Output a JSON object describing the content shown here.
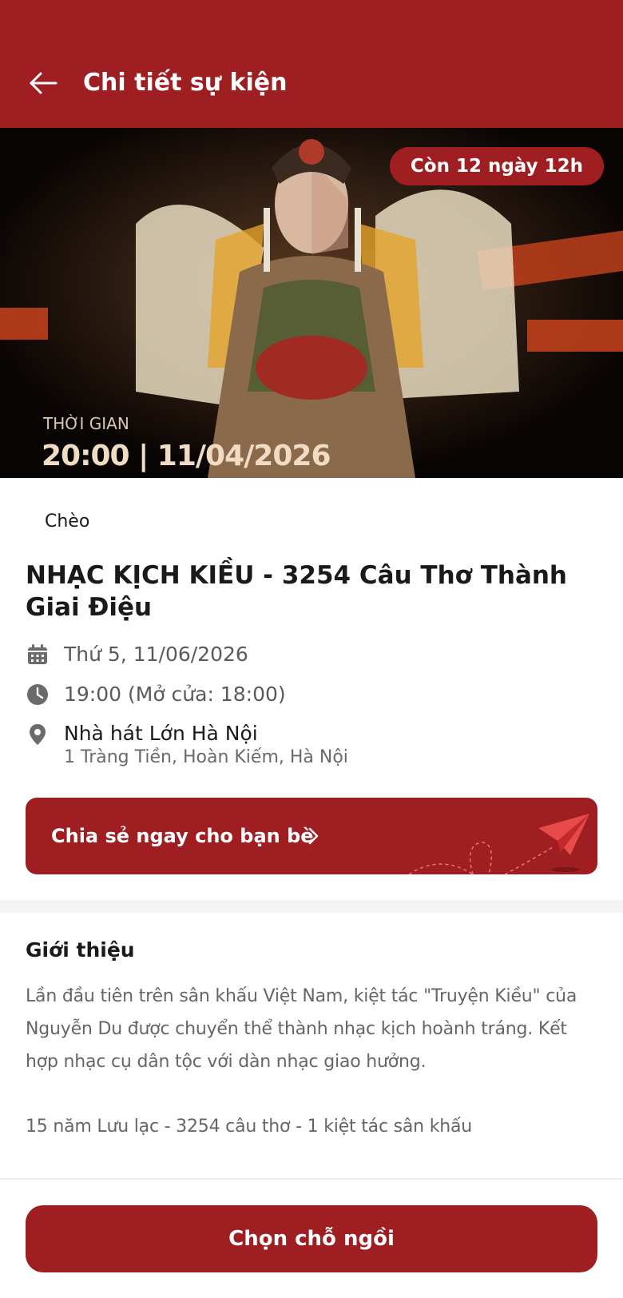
{
  "header": {
    "title": "Chi tiết sự kiện",
    "back_icon": "arrow-left-icon"
  },
  "hero": {
    "countdown": "Còn 12 ngày 12h",
    "time_label": "THỜI GIAN",
    "time_value": "20:00 | 11/04/2026"
  },
  "event": {
    "category": "Chèo",
    "title": "NHẠC KỊCH KIỀU - 3254 Câu Thơ Thành Giai Điệu",
    "date": "Thứ 5, 11/06/2026",
    "time": "19:00 (Mở cửa: 18:00)",
    "venue_name": "Nhà hát Lớn Hà Nội",
    "venue_address": "1 Tràng Tiền, Hoàn Kiếm, Hà Nội"
  },
  "share": {
    "label": "Chia sẻ ngay cho bạn bè"
  },
  "intro": {
    "heading": "Giới thiệu",
    "body": "Lần đầu tiên trên sân khấu Việt Nam, kiệt tác \"Truyện Kiều\" của Nguyễn Du được chuyển thể thành nhạc kịch hoành tráng. Kết hợp nhạc cụ dân tộc với dàn nhạc giao hưởng.",
    "tagline": "15 năm Lưu lạc - 3254 câu thơ - 1 kiệt tác sân khấu"
  },
  "footer": {
    "cta": "Chọn chỗ ngồi"
  },
  "colors": {
    "primary": "#9e1e22",
    "text_dark": "#1a1a1a",
    "text_muted": "#666666"
  }
}
